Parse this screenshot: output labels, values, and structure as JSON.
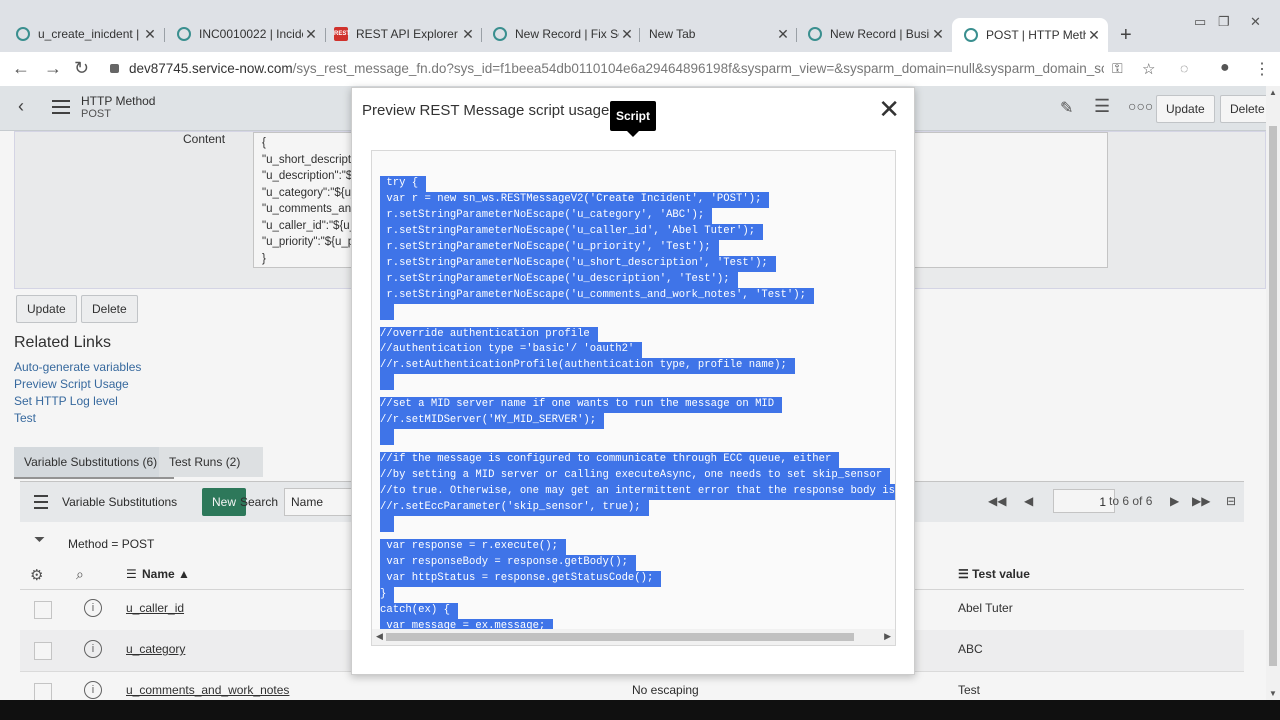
{
  "browser": {
    "tabs": [
      {
        "label": "u_create_inicdent |",
        "icon": "servicenow-icon"
      },
      {
        "label": "INC0010022 | Incide",
        "icon": "servicenow-icon"
      },
      {
        "label": "REST API Explorer",
        "icon": "rest-api-icon"
      },
      {
        "label": "New Record | Fix Sc",
        "icon": "servicenow-icon"
      },
      {
        "label": "New Tab",
        "icon": ""
      },
      {
        "label": "New Record | Busin",
        "icon": "servicenow-icon"
      },
      {
        "label": "POST | HTTP Metho",
        "icon": "servicenow-icon"
      }
    ],
    "url_main": "dev87745.service-now.com",
    "url_rest": "/sys_rest_message_fn.do?sys_id=f1beea54db0110104e6a29464896198f&sysparm_view=&sysparm_domain=null&sysparm_domain_scope...",
    "rest_icon_text": "REST"
  },
  "header": {
    "title": "HTTP Method",
    "subtitle": "POST",
    "update_label": "Update",
    "delete_label": "Delete"
  },
  "form": {
    "content_label": "Content",
    "content_lines": [
      "{",
      "\"u_short_description",
      "\"u_description\":\"${u",
      "\"u_category\":\"${u_c",
      "\"u_comments_and_",
      "\"u_caller_id\":\"${u_c",
      "\"u_priority\":\"${u_pr",
      "}"
    ],
    "update_label": "Update",
    "delete_label": "Delete"
  },
  "related": {
    "heading": "Related Links",
    "links": [
      "Auto-generate variables",
      "Preview Script Usage",
      "Set HTTP Log level",
      "Test"
    ]
  },
  "list": {
    "tabs": [
      "Variable Substitutions (6)",
      "Test Runs (2)"
    ],
    "title": "Variable Substitutions",
    "new_label": "New",
    "search_label": "Search",
    "search_field": "Name",
    "page_value": "1",
    "page_total": "to 6 of 6",
    "filter_text": "Method = POST",
    "col_name": "Name",
    "col_test_value": "Test value",
    "rows": [
      {
        "name": "u_caller_id",
        "escaping": "",
        "value": "Abel Tuter"
      },
      {
        "name": "u_category",
        "escaping": "",
        "value": "ABC"
      },
      {
        "name": "u_comments_and_work_notes",
        "escaping": "No escaping",
        "value": "Test"
      }
    ]
  },
  "modal": {
    "title": "Preview REST Message script usage",
    "tooltip": "Script",
    "code_lines": [
      " try {",
      " var r = new sn_ws.RESTMessageV2('Create Incident', 'POST');",
      " r.setStringParameterNoEscape('u_category', 'ABC');",
      " r.setStringParameterNoEscape('u_caller_id', 'Abel Tuter');",
      " r.setStringParameterNoEscape('u_priority', 'Test');",
      " r.setStringParameterNoEscape('u_short_description', 'Test');",
      " r.setStringParameterNoEscape('u_description', 'Test');",
      " r.setStringParameterNoEscape('u_comments_and_work_notes', 'Test');",
      "",
      "//override authentication profile",
      "//authentication type ='basic'/ 'oauth2'",
      "//r.setAuthenticationProfile(authentication type, profile name);",
      "",
      "//set a MID server name if one wants to run the message on MID",
      "//r.setMIDServer('MY_MID_SERVER');",
      "",
      "//if the message is configured to communicate through ECC queue, either",
      "//by setting a MID server or calling executeAsync, one needs to set skip_sensor",
      "//to true. Otherwise, one may get an intermittent error that the response body is n",
      "//r.setEccParameter('skip_sensor', true);",
      "",
      " var response = r.execute();",
      " var responseBody = response.getBody();",
      " var httpStatus = response.getStatusCode();",
      "}",
      "catch(ex) {",
      " var message = ex.message;",
      "}"
    ]
  },
  "colors": {
    "selection": "#3f74e8",
    "new_button": "#2f7d5e",
    "link": "#3a6ea5"
  }
}
